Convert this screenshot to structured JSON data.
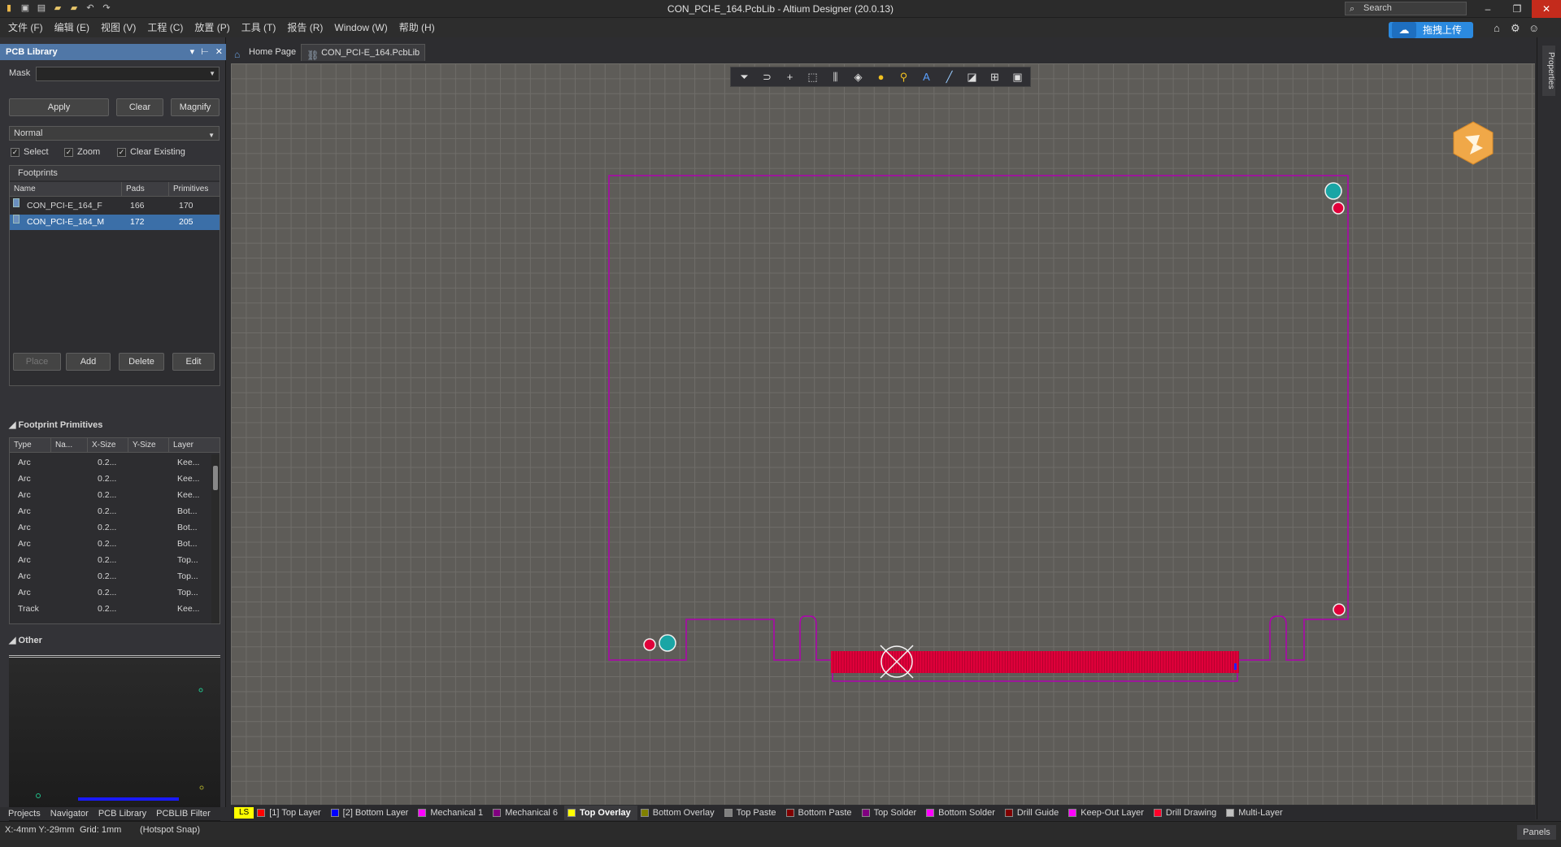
{
  "window": {
    "title": "CON_PCI-E_164.PcbLib - Altium Designer (20.0.13)",
    "search_placeholder": "Search",
    "upload_label": "拖拽上传",
    "minimize": "–",
    "restore": "❐",
    "close": "✕"
  },
  "menus": [
    "文件 (F)",
    "编辑 (E)",
    "视图 (V)",
    "工程 (C)",
    "放置 (P)",
    "工具 (T)",
    "报告 (R)",
    "Window (W)",
    "帮助 (H)"
  ],
  "panel": {
    "title": "PCB Library",
    "mask_label": "Mask",
    "mask_value": "",
    "apply": "Apply",
    "clear": "Clear",
    "magnify": "Magnify",
    "mode": "Normal",
    "checks": [
      {
        "label": "Select",
        "checked": true
      },
      {
        "label": "Zoom",
        "checked": true
      },
      {
        "label": "Clear Existing",
        "checked": true
      }
    ],
    "footprints_title": "Footprints",
    "fp_cols": [
      "Name",
      "Pads",
      "Primitives"
    ],
    "footprints": [
      {
        "name": "CON_PCI-E_164_F",
        "pads": "166",
        "primitives": "170",
        "selected": false
      },
      {
        "name": "CON_PCI-E_164_M",
        "pads": "172",
        "primitives": "205",
        "selected": true
      }
    ],
    "place": "Place",
    "add": "Add",
    "delete": "Delete",
    "edit": "Edit",
    "primitives_title": "Footprint Primitives",
    "prim_cols": [
      "Type",
      "Na...",
      "X-Size",
      "Y-Size",
      "Layer"
    ],
    "primitives": [
      {
        "type": "Arc",
        "xsize": "0.2...",
        "layer": "Kee..."
      },
      {
        "type": "Arc",
        "xsize": "0.2...",
        "layer": "Kee..."
      },
      {
        "type": "Arc",
        "xsize": "0.2...",
        "layer": "Kee..."
      },
      {
        "type": "Arc",
        "xsize": "0.2...",
        "layer": "Bot..."
      },
      {
        "type": "Arc",
        "xsize": "0.2...",
        "layer": "Bot..."
      },
      {
        "type": "Arc",
        "xsize": "0.2...",
        "layer": "Bot..."
      },
      {
        "type": "Arc",
        "xsize": "0.2...",
        "layer": "Top..."
      },
      {
        "type": "Arc",
        "xsize": "0.2...",
        "layer": "Top..."
      },
      {
        "type": "Arc",
        "xsize": "0.2...",
        "layer": "Top..."
      },
      {
        "type": "Track",
        "xsize": "0.2...",
        "layer": "Kee..."
      }
    ],
    "other_title": "Other",
    "bottom_tabs": [
      "Projects",
      "Navigator",
      "PCB Library",
      "PCBLIB Filter"
    ]
  },
  "doc_tabs": [
    {
      "label": "Home Page",
      "active": false
    },
    {
      "label": "CON_PCI-E_164.PcbLib",
      "active": true
    }
  ],
  "right_strip": {
    "properties": "Properties"
  },
  "layers": {
    "ls": "LS",
    "items": [
      {
        "label": "[1] Top Layer",
        "color": "#ff0000"
      },
      {
        "label": "[2] Bottom Layer",
        "color": "#0000ff"
      },
      {
        "label": "Mechanical 1",
        "color": "#ff00ff"
      },
      {
        "label": "Mechanical 6",
        "color": "#800080"
      },
      {
        "label": "Top Overlay",
        "color": "#ffff00",
        "active": true
      },
      {
        "label": "Bottom Overlay",
        "color": "#808000"
      },
      {
        "label": "Top Paste",
        "color": "#808080"
      },
      {
        "label": "Bottom Paste",
        "color": "#800000"
      },
      {
        "label": "Top Solder",
        "color": "#800080"
      },
      {
        "label": "Bottom Solder",
        "color": "#ff00ff"
      },
      {
        "label": "Drill Guide",
        "color": "#800000"
      },
      {
        "label": "Keep-Out Layer",
        "color": "#ff00ff"
      },
      {
        "label": "Drill Drawing",
        "color": "#ff002a"
      },
      {
        "label": "Multi-Layer",
        "color": "#c0c0c0"
      }
    ]
  },
  "status": {
    "coords": "X:-4mm Y:-29mm",
    "grid": "Grid: 1mm",
    "snap": "(Hotspot Snap)",
    "panels": "Panels"
  },
  "colors": {
    "accent": "#2b8ae0",
    "outline": "#b000b0",
    "pad_red": "#e0003a",
    "via_teal": "#1aa5a5"
  }
}
